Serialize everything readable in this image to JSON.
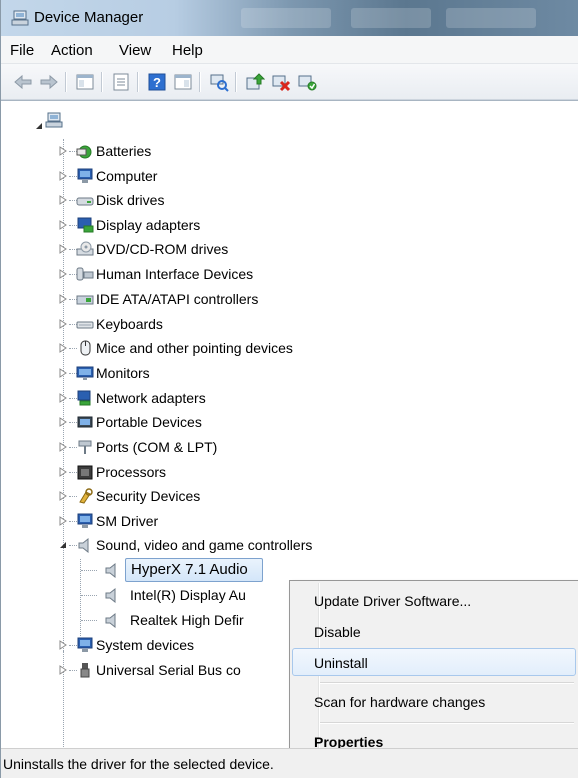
{
  "window": {
    "title": "Device Manager"
  },
  "menu": [
    "File",
    "Action",
    "View",
    "Help"
  ],
  "tree": {
    "categories": [
      {
        "label": "Batteries",
        "icon": "battery-icon"
      },
      {
        "label": "Computer",
        "icon": "computer-icon"
      },
      {
        "label": "Disk drives",
        "icon": "disk-drive-icon"
      },
      {
        "label": "Display adapters",
        "icon": "display-adapter-icon"
      },
      {
        "label": "DVD/CD-ROM drives",
        "icon": "dvd-drive-icon"
      },
      {
        "label": "Human Interface Devices",
        "icon": "hid-icon"
      },
      {
        "label": "IDE ATA/ATAPI controllers",
        "icon": "ide-controller-icon"
      },
      {
        "label": "Keyboards",
        "icon": "keyboard-icon"
      },
      {
        "label": "Mice and other pointing devices",
        "icon": "mouse-icon"
      },
      {
        "label": "Monitors",
        "icon": "monitor-icon"
      },
      {
        "label": "Network adapters",
        "icon": "network-adapter-icon"
      },
      {
        "label": "Portable Devices",
        "icon": "portable-device-icon"
      },
      {
        "label": "Ports (COM & LPT)",
        "icon": "port-icon"
      },
      {
        "label": "Processors",
        "icon": "processor-icon"
      },
      {
        "label": "Security Devices",
        "icon": "security-device-icon"
      },
      {
        "label": "SM Driver",
        "icon": "sm-driver-icon"
      },
      {
        "label": "Sound, video and game controllers",
        "icon": "speaker-icon"
      },
      {
        "label": "System devices",
        "icon": "system-device-icon"
      },
      {
        "label": "Universal Serial Bus co",
        "icon": "usb-icon"
      }
    ],
    "sound_children": [
      {
        "label": "HyperX 7.1 Audio"
      },
      {
        "label": "Intel(R) Display Au"
      },
      {
        "label": "Realtek High Defir"
      }
    ]
  },
  "context_menu": {
    "update": "Update Driver Software...",
    "disable": "Disable",
    "uninstall": "Uninstall",
    "scan": "Scan for hardware changes",
    "properties": "Properties"
  },
  "status": {
    "text": "Uninstalls the driver for the selected device."
  },
  "colors": {
    "selection_border": "#7da2ce",
    "hover_border": "#a8c8ec",
    "menu_bg": "#f1f1f1"
  }
}
